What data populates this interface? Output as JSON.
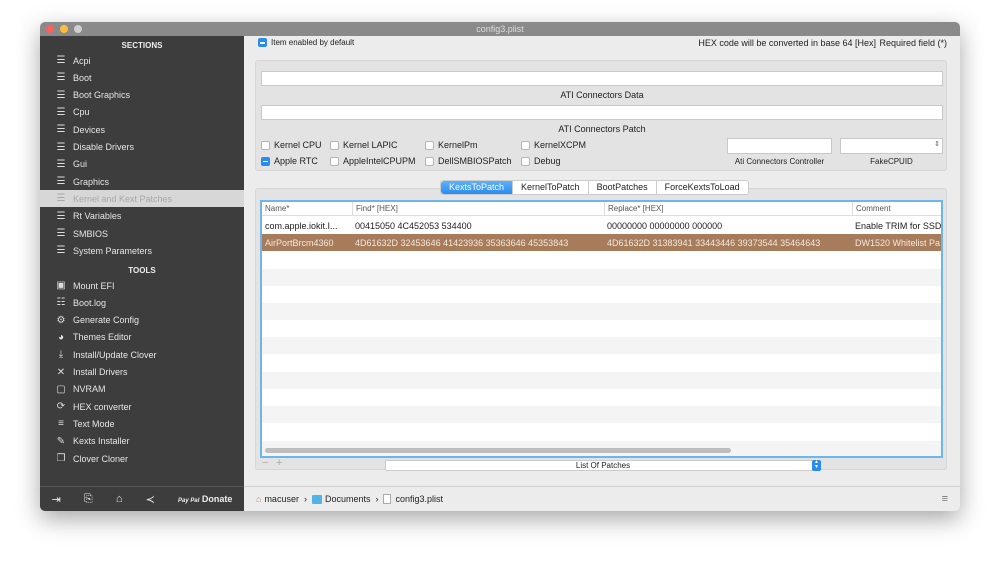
{
  "window": {
    "title": "config3.plist"
  },
  "sidebar": {
    "sections_header": "SECTIONS",
    "sections": [
      {
        "label": "Acpi"
      },
      {
        "label": "Boot"
      },
      {
        "label": "Boot Graphics"
      },
      {
        "label": "Cpu"
      },
      {
        "label": "Devices"
      },
      {
        "label": "Disable Drivers"
      },
      {
        "label": "Gui"
      },
      {
        "label": "Graphics"
      },
      {
        "label": "Kernel and Kext Patches",
        "selected": true
      },
      {
        "label": "Rt Variables"
      },
      {
        "label": "SMBIOS"
      },
      {
        "label": "System Parameters"
      }
    ],
    "tools_header": "TOOLS",
    "tools": [
      {
        "label": "Mount EFI",
        "icon": "disk-icon"
      },
      {
        "label": "Boot.log",
        "icon": "log-icon"
      },
      {
        "label": "Generate Config",
        "icon": "gears-icon"
      },
      {
        "label": "Themes Editor",
        "icon": "palette-icon"
      },
      {
        "label": "Install/Update Clover",
        "icon": "download-icon"
      },
      {
        "label": "Install Drivers",
        "icon": "tools-icon"
      },
      {
        "label": "NVRAM",
        "icon": "chip-icon"
      },
      {
        "label": "HEX converter",
        "icon": "refresh-icon"
      },
      {
        "label": "Text Mode",
        "icon": "text-icon"
      },
      {
        "label": "Kexts Installer",
        "icon": "plug-icon"
      },
      {
        "label": "Clover Cloner",
        "icon": "clone-icon"
      }
    ],
    "bottom": {
      "paypal": "Pay Pal",
      "donate": "Donate"
    }
  },
  "main": {
    "enabled_default": "Item enabled by default",
    "hex_note": "HEX code will be converted in base 64 [Hex]",
    "required_note": "Required field (*)",
    "ati_data_label": "ATI Connectors Data",
    "ati_patch_label": "ATI Connectors Patch",
    "checkboxes": [
      {
        "label": "Kernel CPU",
        "checked": false
      },
      {
        "label": "Kernel LAPIC",
        "checked": false
      },
      {
        "label": "KernelPm",
        "checked": false
      },
      {
        "label": "KernelXCPM",
        "checked": false
      },
      {
        "label": "Apple RTC",
        "checked": true
      },
      {
        "label": "AppleIntelCPUPM",
        "checked": false
      },
      {
        "label": "DellSMBIOSPatch",
        "checked": false
      },
      {
        "label": "Debug",
        "checked": false
      }
    ],
    "ati_controller_label": "Ati Connectors Controller",
    "fakecpuid_label": "FakeCPUID",
    "tabs": [
      {
        "label": "KextsToPatch",
        "active": true
      },
      {
        "label": "KernelToPatch"
      },
      {
        "label": "BootPatches"
      },
      {
        "label": "ForceKextsToLoad"
      }
    ],
    "table": {
      "columns": [
        "Name*",
        "Find* [HEX]",
        "Replace* [HEX]",
        "Comment"
      ],
      "rows": [
        [
          "com.apple.iokit.I...",
          "00415050 4C452053 534400",
          "00000000 00000000 000000",
          "Enable TRIM for SSD"
        ],
        [
          "AirPortBrcm4360",
          "4D61632D 32453646 41423936 35363646 45353843",
          "4D61632D 31383941 33443446 39373544 35464643",
          "DW1520 Whitelist Pa"
        ]
      ],
      "selected_row": 1
    },
    "popup": "List Of Patches",
    "breadcrumb": [
      "macuser",
      "Documents",
      "config3.plist"
    ]
  }
}
